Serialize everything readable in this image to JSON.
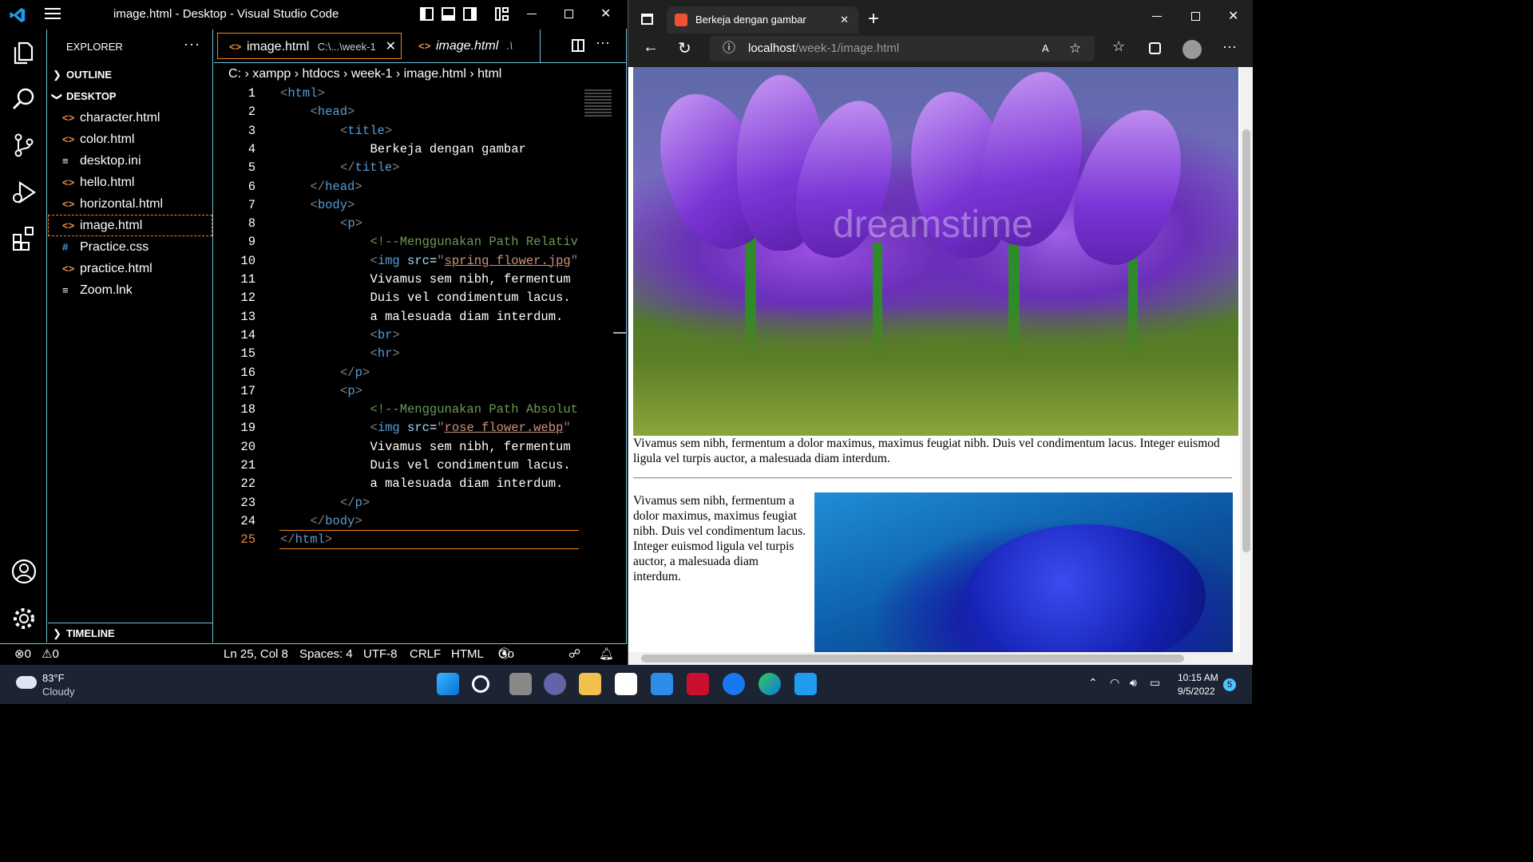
{
  "vscode": {
    "title": "image.html - Desktop - Visual Studio Code",
    "explorer_label": "EXPLORER",
    "outline_label": "OUTLINE",
    "desktop_label": "DESKTOP",
    "timeline_label": "TIMELINE",
    "files": [
      {
        "name": "character.html",
        "icon": "<>"
      },
      {
        "name": "color.html",
        "icon": "<>"
      },
      {
        "name": "desktop.ini",
        "icon": "≡"
      },
      {
        "name": "hello.html",
        "icon": "<>"
      },
      {
        "name": "horizontal.html",
        "icon": "<>"
      },
      {
        "name": "image.html",
        "icon": "<>",
        "selected": true
      },
      {
        "name": "Practice.css",
        "icon": "#"
      },
      {
        "name": "practice.html",
        "icon": "<>"
      },
      {
        "name": "Zoom.lnk",
        "icon": "≡"
      }
    ],
    "tabs": [
      {
        "label": "image.html",
        "path": "C:\\...\\week-1"
      },
      {
        "label": "image.html",
        "path": ".\\"
      }
    ],
    "breadcrumb": [
      "C:",
      "xampp",
      "htdocs",
      "week-1",
      "image.html",
      "html"
    ],
    "code_lines": [
      "<html>",
      "<head>",
      "<title>",
      "Berkeja dengan gambar",
      "</title>",
      "</head>",
      "<body>",
      "<p>",
      "<!--Menggunakan Path Relativ",
      "<img src=\"spring flower.jpg\"",
      "Vivamus sem nibh, fermentum",
      "Duis vel condimentum lacus.",
      "a malesuada diam interdum.",
      "<br>",
      "<hr>",
      "</p>",
      "<p>",
      "<!--Menggunakan Path Absolut",
      "<img src=\"rose flower.webp\"",
      "Vivamus sem nibh, fermentum",
      "Duis vel condimentum lacus.",
      "a malesuada diam interdum.",
      "</p>",
      "</body>",
      "</html>"
    ],
    "status": {
      "errors": "0",
      "warnings": "0",
      "position": "Ln 25, Col 8",
      "spaces": "Spaces: 4",
      "encoding": "UTF-8",
      "eol": "CRLF",
      "language": "HTML",
      "golive": "Go Live"
    }
  },
  "browser": {
    "tab_title": "Berkeja dengan gambar",
    "url_host": "localhost",
    "url_path": "/week-1/image.html",
    "paragraph1": "Vivamus sem nibh, fermentum a dolor maximus, maximus feugiat nibh. Duis vel condimentum lacus. Integer euismod ligula vel turpis auctor, a malesuada diam interdum.",
    "paragraph2": "Vivamus sem nibh, fermentum a dolor maximus, maximus feugiat nibh. Duis vel condimentum lacus. Integer euismod ligula vel turpis auctor, a malesuada diam interdum.",
    "watermark": "dreamstime"
  },
  "taskbar": {
    "weather_temp": "83°F",
    "weather_desc": "Cloudy",
    "time": "10:15 AM",
    "date": "9/5/2022",
    "notification_count": "5"
  }
}
